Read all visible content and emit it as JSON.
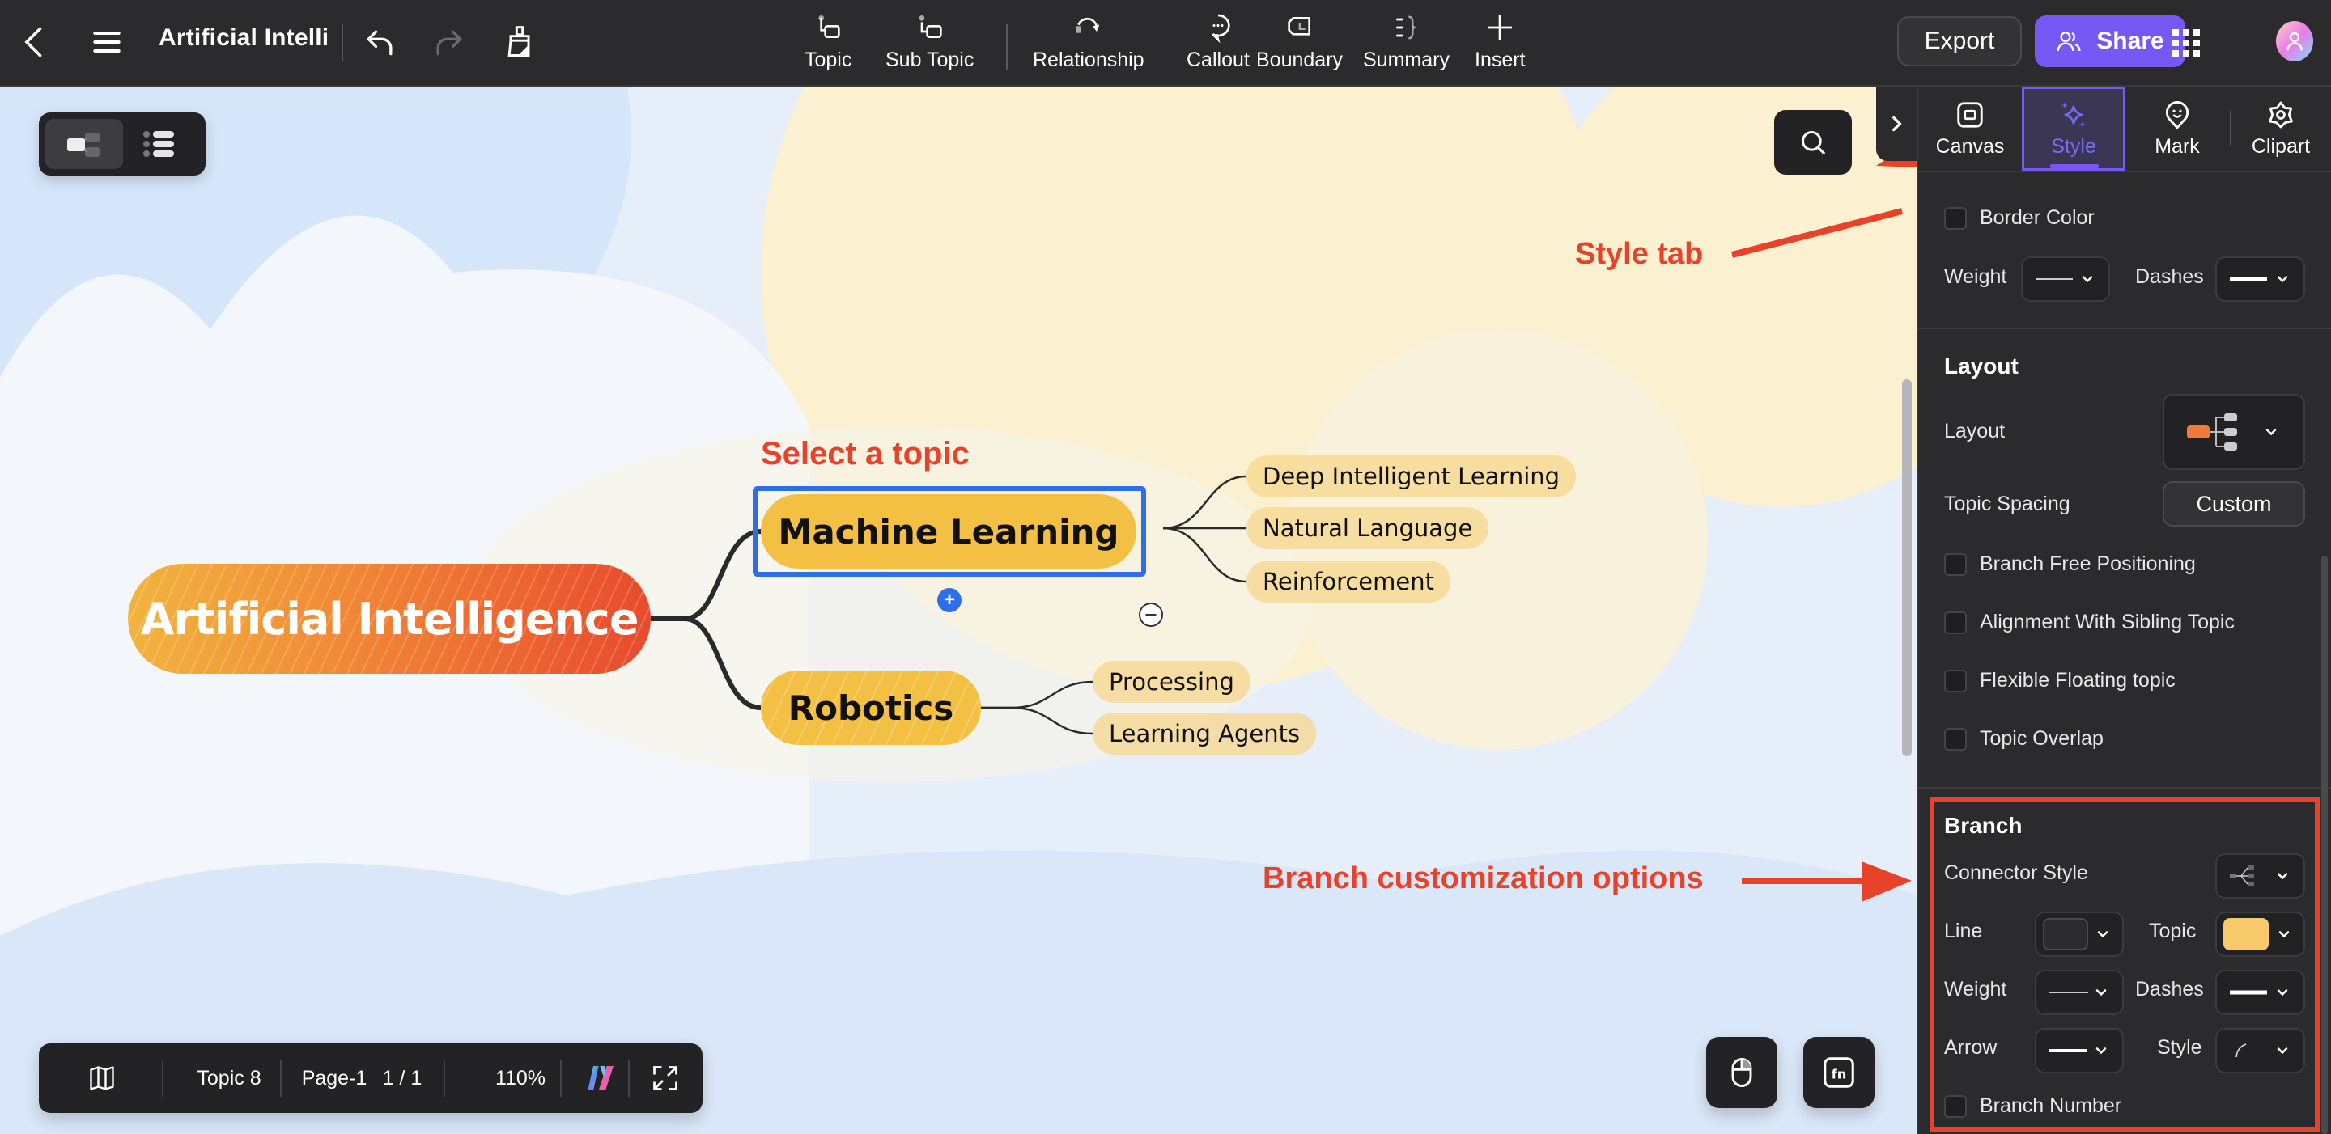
{
  "topbar": {
    "doc_title": "Artificial Intelli",
    "icons": {
      "back": "chevron-left-icon",
      "menu": "hamburger-menu-icon",
      "undo": "undo-icon",
      "redo": "redo-icon",
      "format_painter": "format-painter-icon"
    },
    "tools": [
      {
        "label": "Topic",
        "icon": "topic-icon"
      },
      {
        "label": "Sub Topic",
        "icon": "sub-topic-icon"
      },
      {
        "label": "Relationship",
        "icon": "relationship-icon"
      },
      {
        "label": "Callout",
        "icon": "callout-icon"
      },
      {
        "label": "Boundary",
        "icon": "boundary-icon"
      },
      {
        "label": "Summary",
        "icon": "summary-icon"
      },
      {
        "label": "Insert",
        "icon": "plus-icon"
      }
    ],
    "export_label": "Export",
    "share_label": "Share",
    "colors": {
      "share_bg": "#7459f4",
      "bar_bg": "#2b2b2d"
    }
  },
  "canvas": {
    "view_switch": [
      {
        "name": "mind-map-view",
        "active": true
      },
      {
        "name": "outline-view",
        "active": false
      }
    ],
    "mindmap": {
      "root": "Artificial Intelligence",
      "topics": [
        {
          "label": "Machine Learning",
          "selected": true,
          "subtopics": [
            "Deep Intelligent Learning",
            "Natural Language",
            "Reinforcement"
          ]
        },
        {
          "label": "Robotics",
          "selected": false,
          "subtopics": [
            "Processing",
            "Learning Agents"
          ]
        }
      ],
      "collapse_symbol": "−",
      "add_symbol": "+"
    },
    "annotations": {
      "select_topic": "Select a topic",
      "style_tab": "Style tab",
      "branch_options": "Branch customization options",
      "color": "#e8432a"
    },
    "status_bar": {
      "topic_count": "Topic 8",
      "page_name": "Page-1",
      "page_index": "1 / 1",
      "zoom": "110%"
    }
  },
  "panel": {
    "tabs": [
      {
        "label": "Canvas",
        "icon": "canvas-icon",
        "active": false
      },
      {
        "label": "Style",
        "icon": "sparkle-icon",
        "active": true
      },
      {
        "label": "Mark",
        "icon": "mark-icon",
        "active": false
      },
      {
        "label": "Clipart",
        "icon": "clipart-icon",
        "active": false
      }
    ],
    "border": {
      "border_color_label": "Border Color",
      "weight_label": "Weight",
      "dashes_label": "Dashes"
    },
    "layout": {
      "title": "Layout",
      "layout_label": "Layout",
      "topic_spacing_label": "Topic Spacing",
      "topic_spacing_value": "Custom",
      "checkboxes": [
        {
          "label": "Branch Free Positioning",
          "checked": false
        },
        {
          "label": "Alignment With Sibling Topic",
          "checked": false
        },
        {
          "label": "Flexible Floating topic",
          "checked": false
        },
        {
          "label": "Topic Overlap",
          "checked": false
        }
      ]
    },
    "branch": {
      "title": "Branch",
      "connector_style_label": "Connector Style",
      "line_label": "Line",
      "line_color": "#2c2c2e",
      "topic_label": "Topic",
      "topic_color": "#f6c96b",
      "weight_label": "Weight",
      "dashes_label": "Dashes",
      "arrow_label": "Arrow",
      "style_label": "Style",
      "branch_number_label": "Branch Number",
      "branch_number_checked": false
    }
  }
}
